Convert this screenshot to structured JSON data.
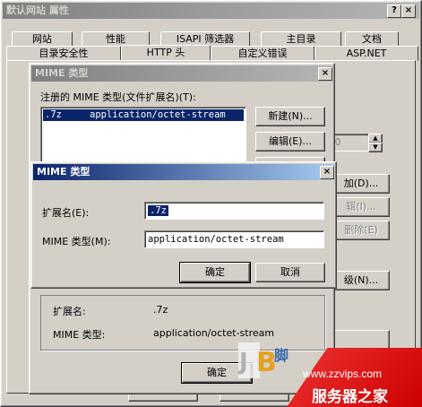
{
  "main_window": {
    "title": "默认网站 属性",
    "help_btn": "?",
    "close_btn": "×",
    "tabs_row1": [
      "网站",
      "性能",
      "ISAPI 筛选器",
      "主目录",
      "文档"
    ],
    "tabs_row2": [
      "目录安全性",
      "HTTP 头",
      "自定义错误",
      "ASP.NET"
    ],
    "add_partial": "加(D)...",
    "edit_partial": "辑(I)...",
    "delete_partial": "删除(E)",
    "level_partial": "级(N)...",
    "num_partial": "00",
    "bottom_ok": "确定"
  },
  "mime_list_dialog": {
    "title": "MIME 类型",
    "list_label": "注册的 MIME 类型(文件扩展名)(T):",
    "items": [
      {
        "ext": ".7z",
        "type": "application/octet-stream",
        "selected": true
      }
    ],
    "new_btn": "新建(N)...",
    "edit_btn": "编辑(E)...",
    "details_ext_label": "扩展名:",
    "details_ext_value": ".7z",
    "details_type_label": "MIME 类型:",
    "details_type_value": "application/octet-stream",
    "ok_btn": "确定"
  },
  "mime_edit_dialog": {
    "title": "MIME 类型",
    "close_btn": "×",
    "ext_label": "扩展名(E):",
    "ext_value": ".7z",
    "type_label": "MIME 类型(M):",
    "type_value": "application/octet-stream",
    "ok_btn": "确定",
    "cancel_btn": "取消"
  },
  "watermark": {
    "url": "www.zzvips.com",
    "name": "服务器之家",
    "logo": "JB 脚本"
  }
}
